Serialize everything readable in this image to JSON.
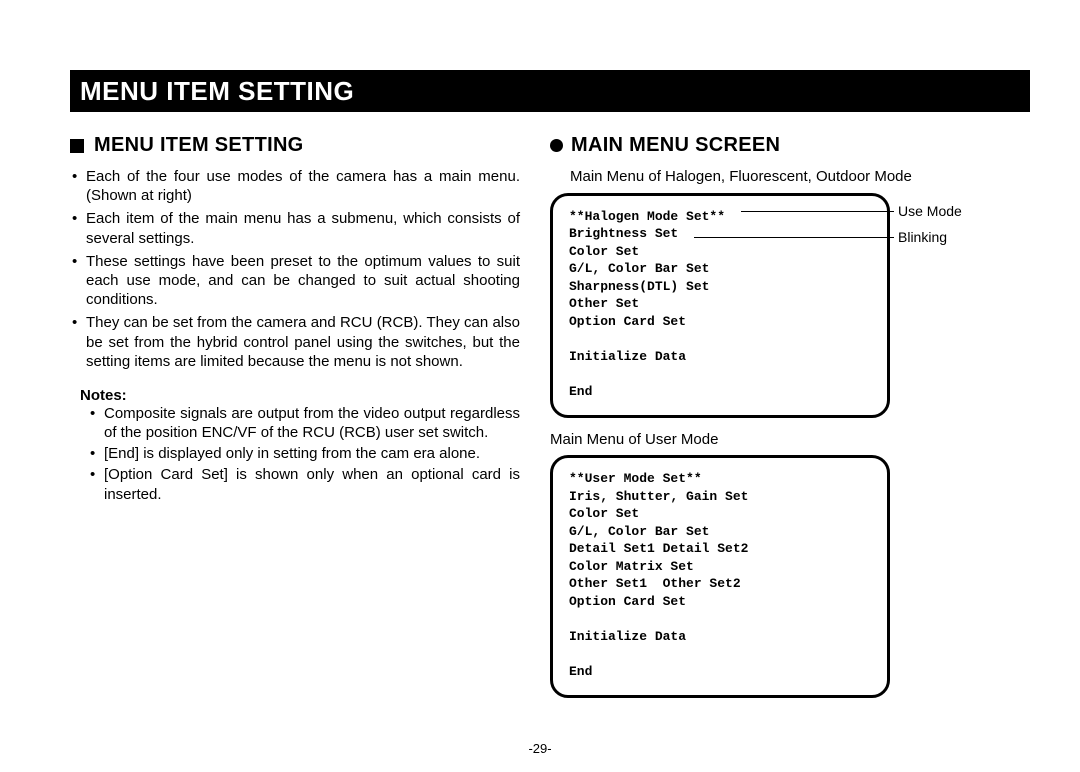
{
  "title_bar": "MENU ITEM SETTING",
  "left": {
    "heading": "MENU ITEM SETTING",
    "bullets": [
      "Each of the four use modes of the camera has a main menu. (Shown at right)",
      "Each item of the main menu has a submenu, which consists of several settings.",
      "These settings have been preset to the optimum values to suit each use mode, and can be changed to suit actual shooting conditions.",
      "They can be set from the camera and RCU (RCB). They can also be set from the hybrid control panel using the switches, but the setting items are limited because the menu is not shown."
    ],
    "notes_label": "Notes:",
    "notes": [
      "Composite signals are output from the video output regardless of the position ENC/VF of the RCU (RCB) user set switch.",
      "[End] is displayed only in setting from the cam era alone.",
      "[Option Card Set] is shown only when an optional card is inserted."
    ]
  },
  "right": {
    "heading": "MAIN MENU SCREEN",
    "caption1": "Main Menu of Halogen, Fluorescent, Outdoor Mode",
    "screen1": "**Halogen Mode Set**\nBrightness Set\nColor Set\nG/L, Color Bar Set\nSharpness(DTL) Set\nOther Set\nOption Card Set\n\nInitialize Data\n\nEnd",
    "callout1": "Use Mode",
    "callout2": "Blinking",
    "caption2": "Main Menu of User Mode",
    "screen2": "**User Mode Set**\nIris, Shutter, Gain Set\nColor Set\nG/L, Color Bar Set\nDetail Set1 Detail Set2\nColor Matrix Set\nOther Set1  Other Set2\nOption Card Set\n\nInitialize Data\n\nEnd"
  },
  "page_number": "-29-"
}
